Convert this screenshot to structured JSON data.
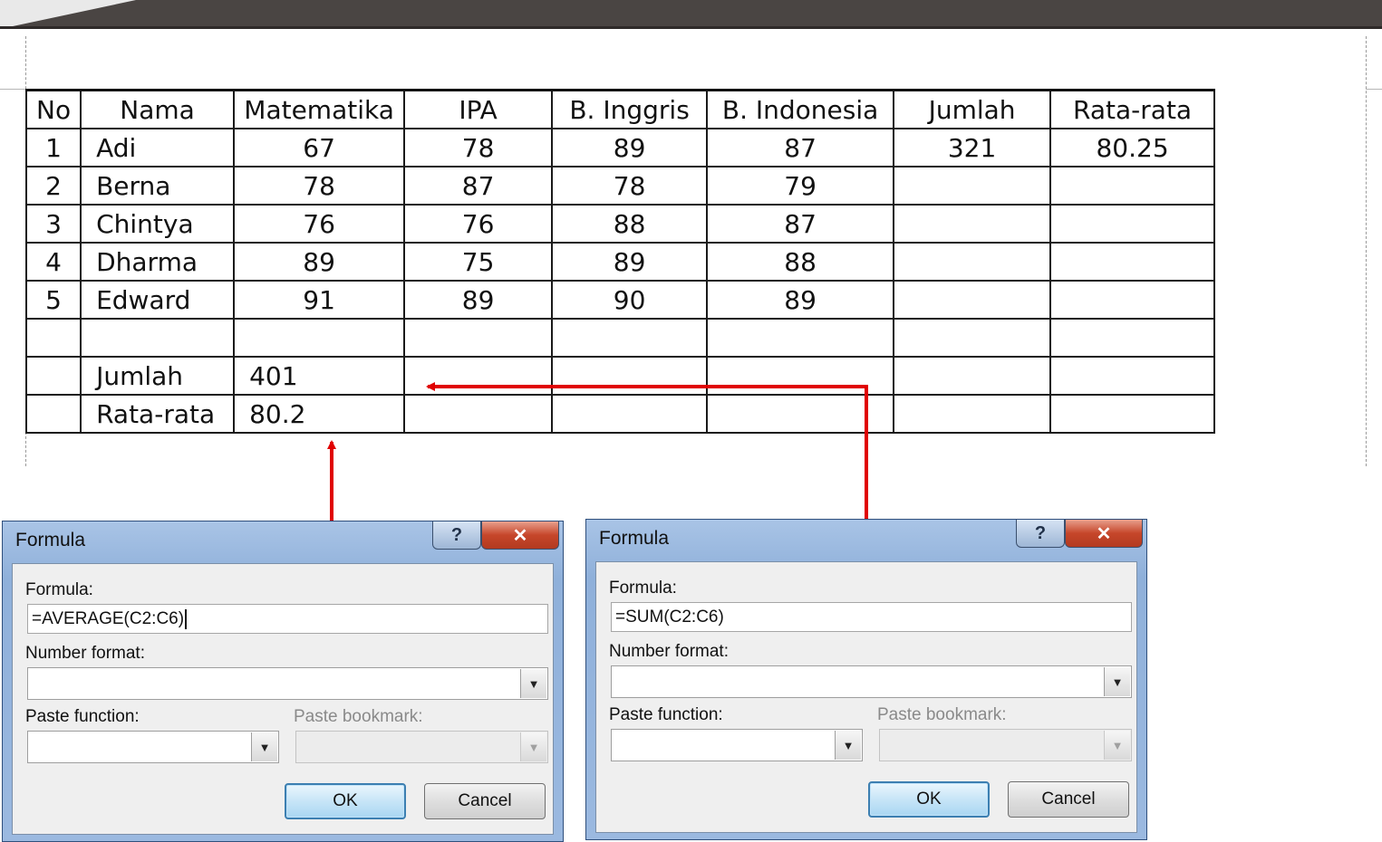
{
  "table": {
    "headers": [
      "No",
      "Nama",
      "Matematika",
      "IPA",
      "B. Inggris",
      "B. Indonesia",
      "Jumlah",
      "Rata-rata"
    ],
    "rows": [
      [
        "1",
        "Adi",
        "67",
        "78",
        "89",
        "87",
        "321",
        "80.25"
      ],
      [
        "2",
        "Berna",
        "78",
        "87",
        "78",
        "79",
        "",
        ""
      ],
      [
        "3",
        "Chintya",
        "76",
        "76",
        "88",
        "87",
        "",
        ""
      ],
      [
        "4",
        "Dharma",
        "89",
        "75",
        "89",
        "88",
        "",
        ""
      ],
      [
        "5",
        "Edward",
        "91",
        "89",
        "90",
        "89",
        "",
        ""
      ],
      [
        "",
        "",
        "",
        "",
        "",
        "",
        "",
        ""
      ],
      [
        "",
        "Jumlah",
        "401",
        "",
        "",
        "",
        "",
        ""
      ],
      [
        "",
        "Rata-rata",
        "80.2",
        "",
        "",
        "",
        "",
        ""
      ]
    ]
  },
  "dialogs": [
    {
      "title": "Formula",
      "help_label": "?",
      "close_label": "✕",
      "formula_label": "Formula:",
      "formula_value": "=AVERAGE(C2:C6)",
      "number_format_label": "Number format:",
      "number_format_value": "",
      "paste_function_label": "Paste function:",
      "paste_bookmark_label": "Paste bookmark:",
      "ok_label": "OK",
      "cancel_label": "Cancel"
    },
    {
      "title": "Formula",
      "help_label": "?",
      "close_label": "✕",
      "formula_label": "Formula:",
      "formula_value": "=SUM(C2:C6)",
      "number_format_label": "Number format:",
      "number_format_value": "",
      "paste_function_label": "Paste function:",
      "paste_bookmark_label": "Paste bookmark:",
      "ok_label": "OK",
      "cancel_label": "Cancel"
    }
  ],
  "colors": {
    "arrow": "#e00000",
    "dialog_frame": "#9bb9e0",
    "close_button": "#c6462a"
  },
  "icons": {
    "help": "question-icon",
    "close": "close-icon",
    "dropdown": "chevron-down-icon"
  }
}
